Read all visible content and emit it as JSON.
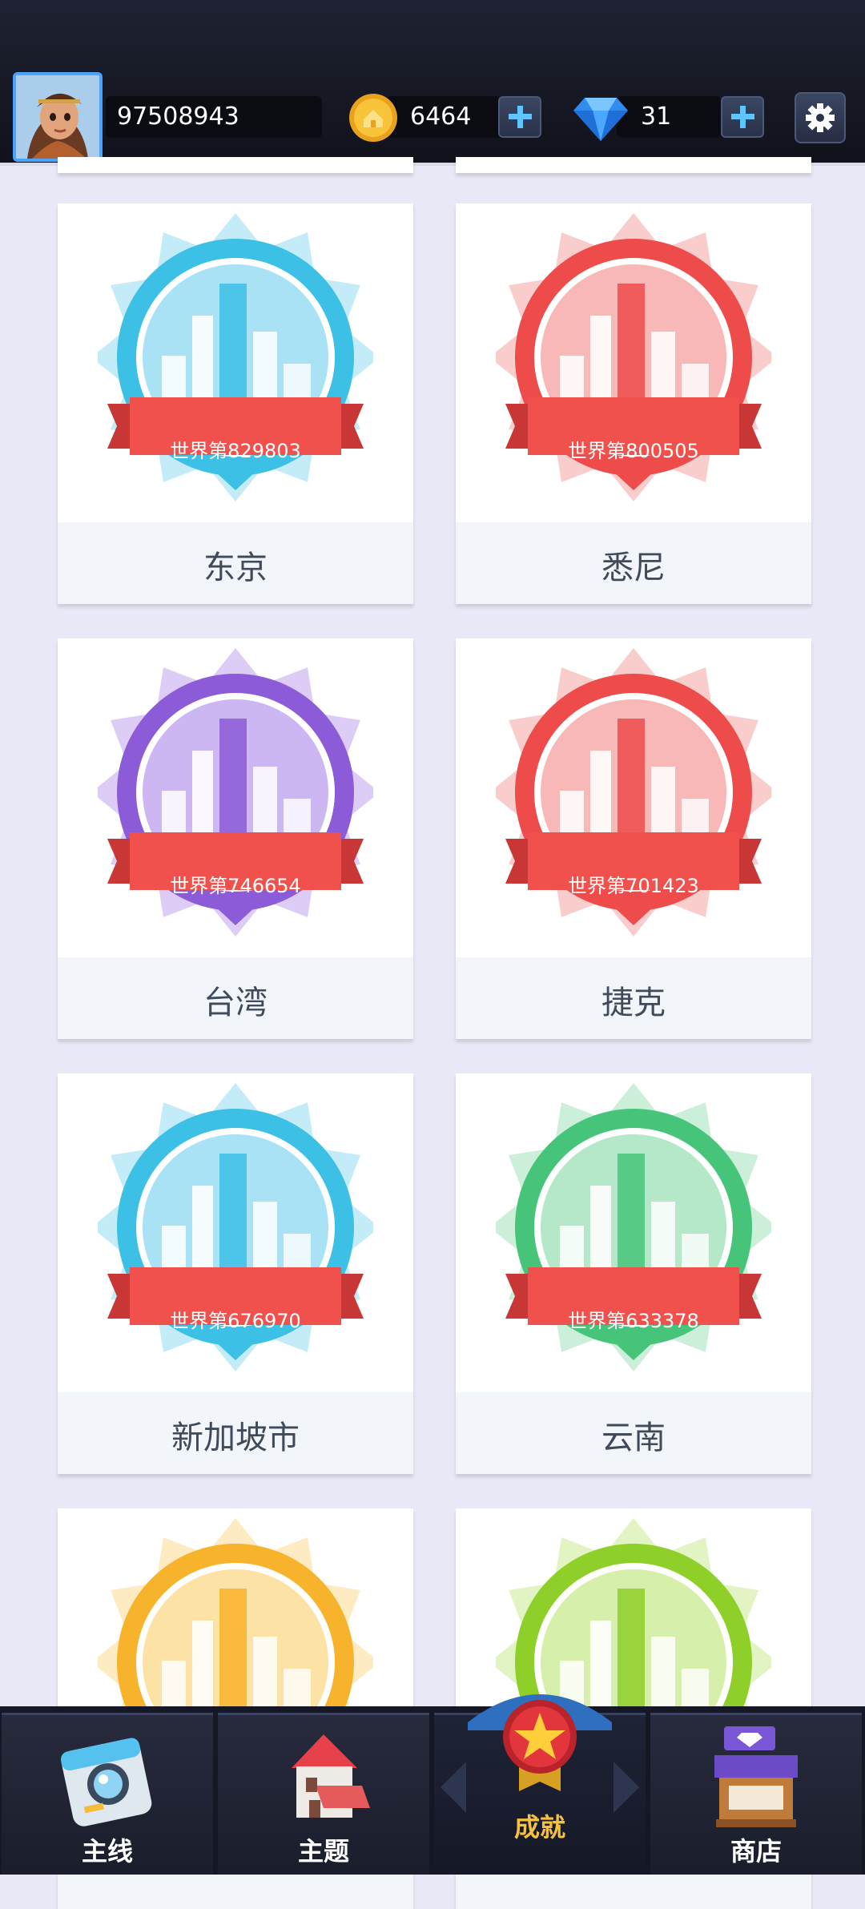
{
  "header": {
    "player_id": "97508943",
    "coins": "6464",
    "gems": "31"
  },
  "cards": [
    {
      "name": "东京",
      "rank": "世界第829803",
      "ring_color": "#3cc0e6",
      "burst_color": "#a9e2f5"
    },
    {
      "name": "悉尼",
      "rank": "世界第800505",
      "ring_color": "#ee4b4b",
      "burst_color": "#f8b8b8"
    },
    {
      "name": "台湾",
      "rank": "世界第746654",
      "ring_color": "#8b5bd8",
      "burst_color": "#cdb7f2"
    },
    {
      "name": "捷克",
      "rank": "世界第701423",
      "ring_color": "#ee4b4b",
      "burst_color": "#f8b8b8"
    },
    {
      "name": "新加坡市",
      "rank": "世界第676970",
      "ring_color": "#3cc0e6",
      "burst_color": "#a9e2f5"
    },
    {
      "name": "云南",
      "rank": "世界第633378",
      "ring_color": "#46c57a",
      "burst_color": "#b5e8c8"
    },
    {
      "name": "",
      "rank": "",
      "ring_color": "#f8b32c",
      "burst_color": "#fde2a6"
    },
    {
      "name": "",
      "rank": "",
      "ring_color": "#8fcf2a",
      "burst_color": "#d6efaa"
    }
  ],
  "nav": {
    "items": [
      {
        "label": "主线",
        "icon": "camera-icon"
      },
      {
        "label": "主题",
        "icon": "house-icon"
      },
      {
        "label": "成就",
        "icon": "medal-star-icon"
      },
      {
        "label": "商店",
        "icon": "shop-icon"
      }
    ],
    "active": "成就"
  }
}
